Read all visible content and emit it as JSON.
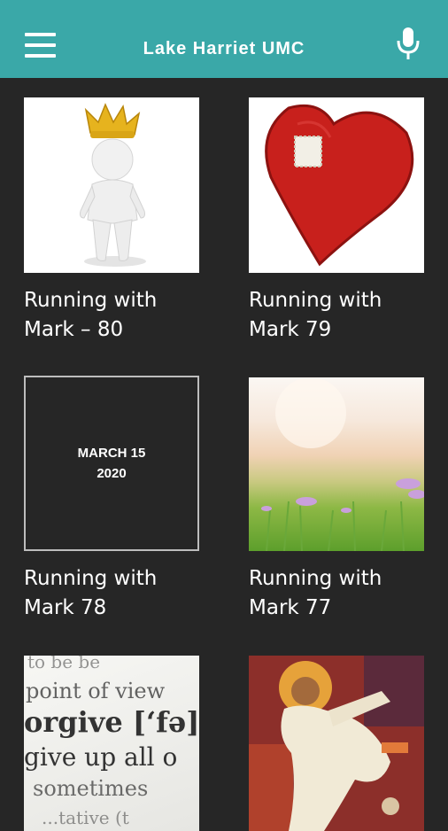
{
  "app_bar": {
    "title": "Lake Harriet UMC",
    "menu_icon": "hamburger-menu-icon",
    "mic_icon": "microphone-icon",
    "background": "#3aa8a8"
  },
  "sermons": [
    {
      "title": "Running with\nMark – 80",
      "thumbnail": "crowned-figure"
    },
    {
      "title": "Running with\nMark 79",
      "thumbnail": "patched-heart"
    },
    {
      "title": "Running with\nMark 78",
      "thumbnail": "date-card",
      "date_text": "MARCH 15\n2020"
    },
    {
      "title": "Running with\nMark 77",
      "thumbnail": "meadow-flowers"
    },
    {
      "title": "",
      "thumbnail": "dictionary-forgive",
      "dictionary_lines": [
        "to be be",
        "point of view",
        "orgive [‘fə]",
        "give up all o",
        "sometimes",
        "...tative (t"
      ]
    },
    {
      "title": "",
      "thumbnail": "painted-figure"
    }
  ]
}
